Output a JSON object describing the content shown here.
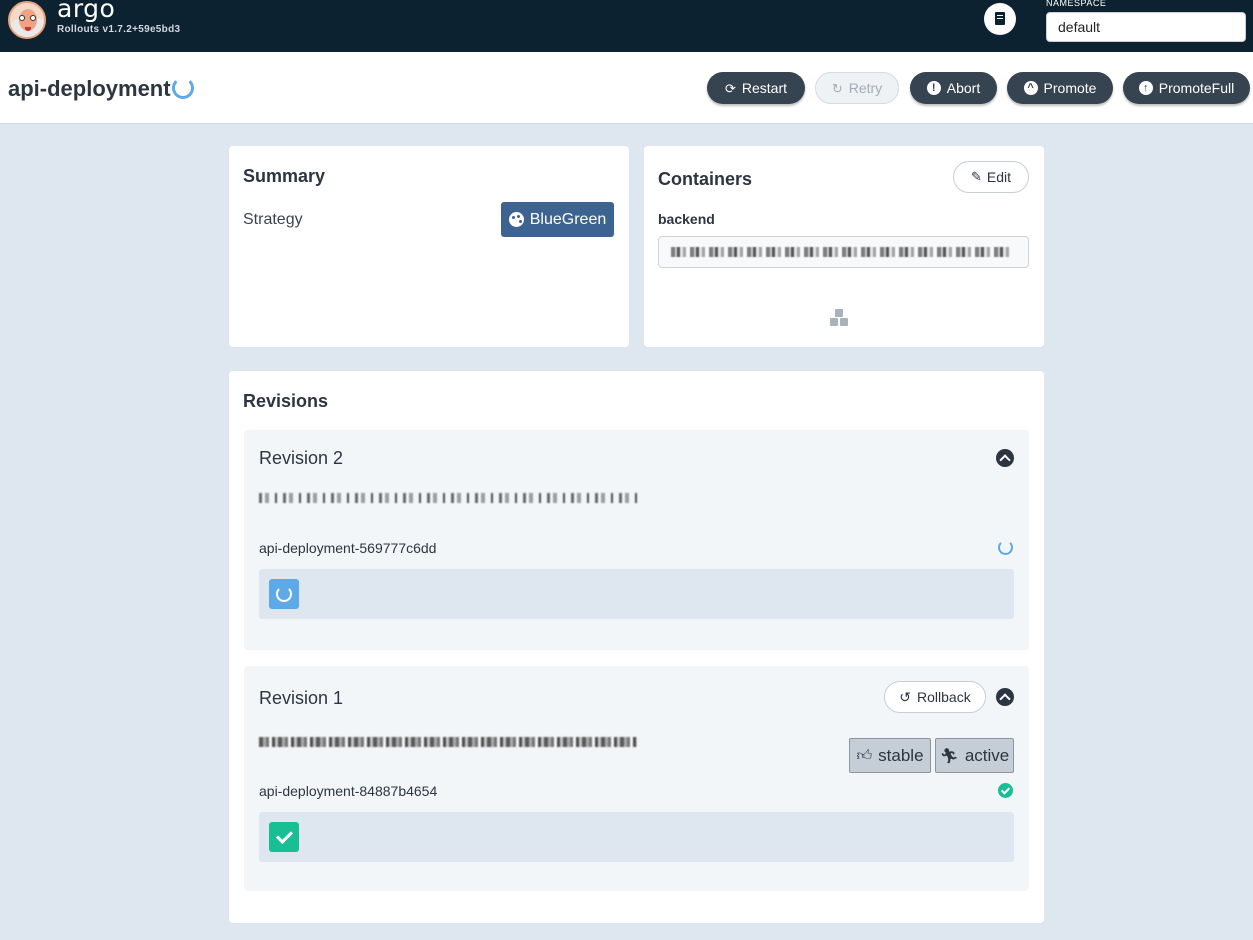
{
  "app": {
    "brand": "argo",
    "version": "Rollouts v1.7.2+59e5bd3",
    "namespace_label": "NAMESPACE",
    "namespace_value": "default"
  },
  "header": {
    "title": "api-deployment",
    "buttons": {
      "restart": "Restart",
      "retry": "Retry",
      "abort": "Abort",
      "promote": "Promote",
      "promote_full": "PromoteFull"
    }
  },
  "summary": {
    "title": "Summary",
    "strategy_label": "Strategy",
    "strategy_value": "BlueGreen"
  },
  "containers": {
    "title": "Containers",
    "edit_label": "Edit",
    "items": [
      {
        "name": "backend"
      }
    ]
  },
  "revisions": {
    "title": "Revisions",
    "items": [
      {
        "title": "Revision 2",
        "replicaset": "api-deployment-569777c6dd",
        "status": "progressing"
      },
      {
        "title": "Revision 1",
        "rollback_label": "Rollback",
        "tags": [
          "stable",
          "active"
        ],
        "replicaset": "api-deployment-84887b4654",
        "status": "healthy"
      }
    ]
  },
  "colors": {
    "topbar": "#0d2231",
    "button_dark": "#364350",
    "strategy_badge": "#3d6491",
    "progress_blue": "#5ea9e8",
    "healthy_green": "#18be94"
  }
}
